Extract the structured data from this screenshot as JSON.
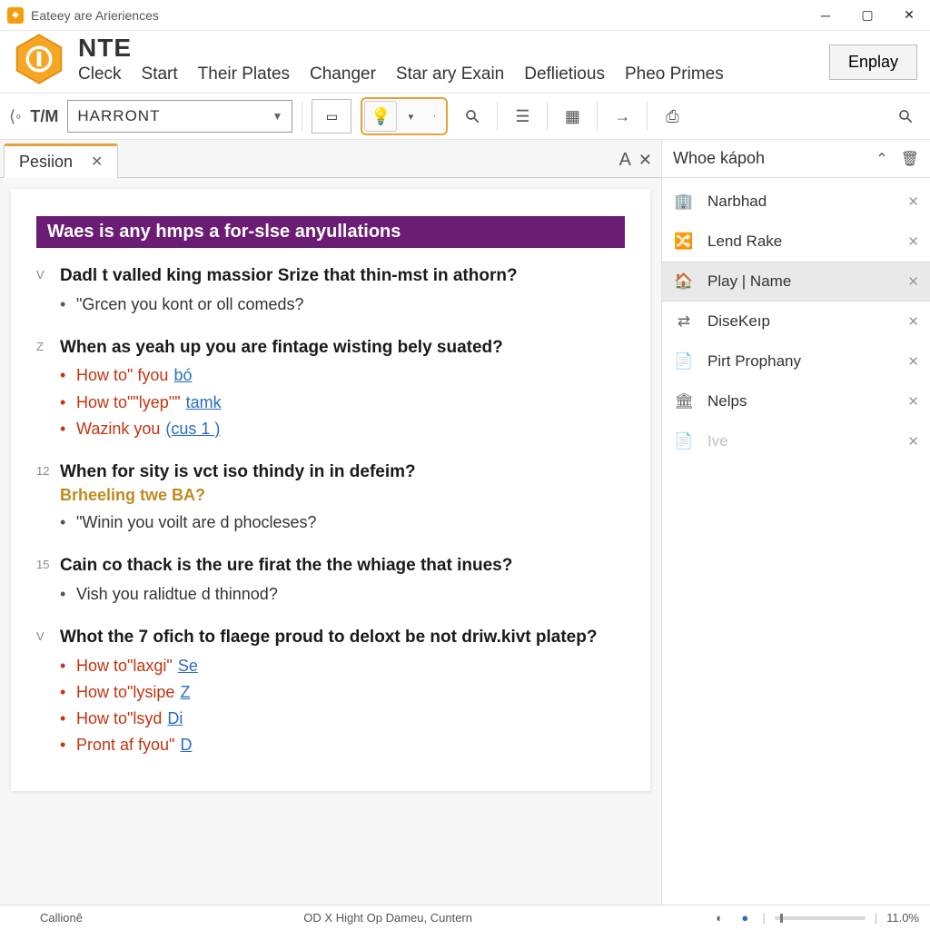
{
  "window": {
    "title": "Eateey are Arieriences"
  },
  "header": {
    "brand": "NTE",
    "menu": [
      "Cleck",
      "Start",
      "Their Plates",
      "Changer",
      "Star ary Exain",
      "Deflietious",
      "Pheo Primes"
    ],
    "button": "Enplay"
  },
  "toolbar": {
    "nav_label": "T/M",
    "select_value": "HARRONT"
  },
  "tabs": {
    "active": "Pesiion"
  },
  "document": {
    "banner": "Waes is any hmps a for-slse anyullations",
    "sections": [
      {
        "marker": "V",
        "title": "Dadl t valled king massior Srize that thin-mst in athorn?",
        "bullets": [
          {
            "text": "\"Grcen you kont or oll comeds?"
          }
        ]
      },
      {
        "marker": "Z",
        "title": "When as yeah up you are fintage wisting bely suated?",
        "bullets_red": true,
        "bullets": [
          {
            "text": "How to\" fyou",
            "link": "bó"
          },
          {
            "text": "How to\"\"lyep\"\"",
            "link": "tamk"
          },
          {
            "text": "Wazink you",
            "link": "(cus 1 )"
          }
        ]
      },
      {
        "marker": "12",
        "title": "When for sity is vct iso thindy in in defeim?",
        "subtitle": "Brheeling twe BA?",
        "bullets": [
          {
            "text": "\"Winin you voilt are d phocleses?"
          }
        ]
      },
      {
        "marker": "15",
        "title": "Cain co thack is the ure firat the the whiage that inues?",
        "bullets": [
          {
            "text": "Vish you ralidtue d thinnod?"
          }
        ]
      },
      {
        "marker": "V",
        "title": "Whot the 7 ofich to flaege proud to deloxt be not driw.kivt platep?",
        "bullets_red": true,
        "bullets": [
          {
            "text": "How to\"laxgi\"",
            "link": "Se"
          },
          {
            "text": "How to\"lysipe",
            "link": "Z"
          },
          {
            "text": "How to\"lsyd",
            "link": "Di"
          },
          {
            "text": "Pront af fyou\"",
            "link": "D"
          }
        ]
      }
    ]
  },
  "panel": {
    "title": "Whoe kápoh",
    "items": [
      {
        "label": "Narbhad",
        "icon": "building"
      },
      {
        "label": "Lend Rake",
        "icon": "flow"
      },
      {
        "label": "Play | Name",
        "icon": "home",
        "selected": true
      },
      {
        "label": "DiseKeıp",
        "icon": "transfer"
      },
      {
        "label": "Pirt Prophany",
        "icon": "doc"
      },
      {
        "label": "Nelps",
        "icon": "building2"
      },
      {
        "label": "Ive",
        "icon": "doc",
        "dim": true
      }
    ]
  },
  "status": {
    "left": "Callionê",
    "center": "OD X   Hight Op Dameu, Cuntern",
    "zoom": "11.0%"
  }
}
